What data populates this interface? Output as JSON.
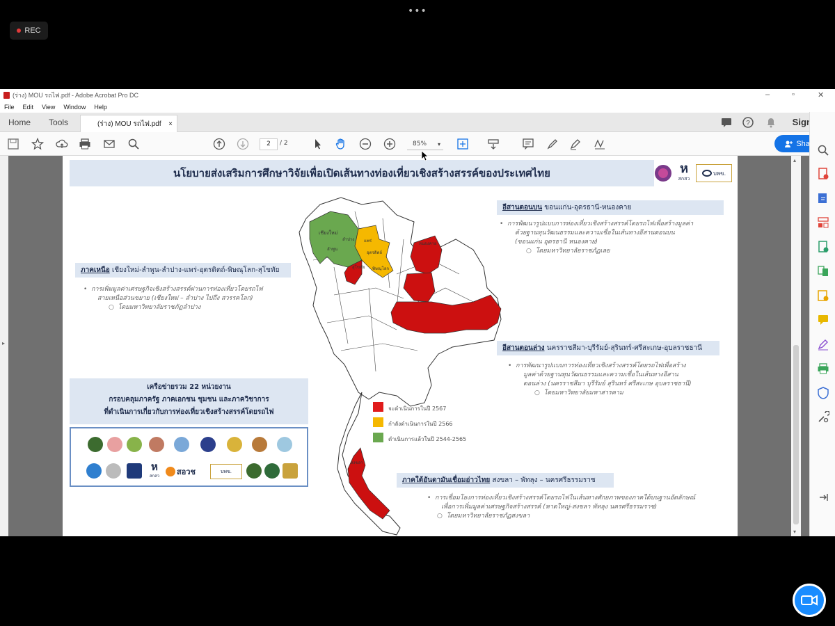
{
  "overlay": {
    "menu_dots": "•••",
    "rec_label": "REC"
  },
  "window": {
    "title": "(ร่าง) MOU  รถไฟ.pdf - Adobe Acrobat Pro DC",
    "menu": [
      "File",
      "Edit",
      "View",
      "Window",
      "Help"
    ],
    "nav": {
      "home": "Home",
      "tools": "Tools"
    },
    "doc_tab": "(ร่าง) MOU  รถไฟ.pdf",
    "doc_tab_close": "×",
    "sign_in": "Sign In"
  },
  "toolbar": {
    "page_current": "2",
    "page_total": "/ 2",
    "zoom": "85%",
    "share_label": "Share"
  },
  "slide": {
    "title": "นโยบายส่งเสริมการศึกษาวิจัยเพื่อเปิดเส้นทางท่องเที่ยวเชิงสร้างสรรค์ของประเทศไทย",
    "logo_texts": [
      "สกสว",
      "บพข."
    ],
    "north": {
      "heading": "ภาคเหนือ",
      "provinces": " เชียงใหม่-ลำพูน-ลำปาง-แพร่-อุตรดิตถ์-พิษณุโลก-สุโขทัย",
      "bullet": "การเพิ่มมูลค่าเศรษฐกิจเชิงสร้างสรรค์ผ่านการท่องเที่ยวโดยรถไฟ",
      "bullet2": "สายเหนือส่วนขยาย (เชียงใหม่ – ลำปาง ไปถึง สวรรคโลก)",
      "sub": "โดยมหาวิทยาลัยราชภัฏลำปาง"
    },
    "isan_upper": {
      "heading": "อีสานตอนบน",
      "provinces": " ขอนแก่น-อุดรธานี-หนองคาย",
      "bullet": "การพัฒนารูปแบบการท่องเที่ยวเชิงสร้างสรรค์โดยรถไฟเพื่อสร้างมูลค่า",
      "bullet2": "ด้วยฐานทุนวัฒนธรรมและความเชื่อในเส้นทางอีสานตอนบน",
      "bullet3": "(ขอนแก่น อุดรธานี หนองคาย)",
      "sub": "โดยมหาวิทยาลัยราชภัฏเลย"
    },
    "isan_lower": {
      "heading": "อีสานตอนล่าง",
      "provinces": " นครราชสีมา-บุรีรัมย์-สุรินทร์-ศรีสะเกษ-อุบลราชธานี",
      "bullet": "การพัฒนารูปแบบการท่องเที่ยวเชิงสร้างสรรค์โดยรถไฟเพื่อสร้าง",
      "bullet2": "มูลค่าด้วยฐานทุนวัฒนธรรมและความเชื่อในเส้นทางอีสาน",
      "bullet3": "ตอนล่าง (นครราชสีมา บุรีรัมย์ สุรินทร์ ศรีสะเกษ อุบลราชธานี)",
      "sub": "โดยมหาวิทยาลัยมหาสารคาม"
    },
    "south": {
      "heading": "ภาคใต้อันดามันเชื่อมอ่าวไทย",
      "provinces": " สงขลา – พัทลุง – นครศรีธรรมราช",
      "bullet": "การเชื่อมโยงการท่องเที่ยวเชิงสร้างสรรค์โดยรถไฟในเส้นทางศักยภาพของภาคใต้บนฐานอัตลักษณ์",
      "bullet2": "เพื่อการเพิ่มมูลค่าเศรษฐกิจสร้างสรรค์ (หาดใหญ่-สงขลา พัทลุง นครศรีธรรมราช)",
      "sub": "โดยมหาวิทยาลัยราชภัฏสงขลา"
    },
    "network": {
      "line1": "เครือข่ายรวม 22 หน่วยงาน",
      "line2": "กรอบคลุมภาครัฐ ภาคเอกชน ชุมชน และภาควิชาการ",
      "line3": "ที่ดำเนินการเกี่ยวกับการท่องเที่ยวเชิงสร้างสรรค์โดยรถไฟ"
    },
    "partner_texts": [
      "สกสว",
      "สอวช",
      "บพข."
    ],
    "legend": [
      {
        "color": "#e01b1b",
        "label": "จะดำเนินการในปี 2567"
      },
      {
        "color": "#f5b800",
        "label": "กำลังดำเนินการในปี 2566"
      },
      {
        "color": "#6aa84f",
        "label": "ดำเนินการแล้วในปี 2544-2565"
      }
    ],
    "map_labels": [
      "เชียงใหม่",
      "ลำปาง",
      "ลำพูน",
      "แพร่",
      "อุตรดิตถ์",
      "สุโขทัย",
      "พิษณุโลก",
      "หนองคาย",
      "สงขลา"
    ],
    "colors": {
      "red": "#cc1010",
      "yellow": "#f5b800",
      "green": "#6aa84f",
      "box": "#dde6f2"
    }
  }
}
